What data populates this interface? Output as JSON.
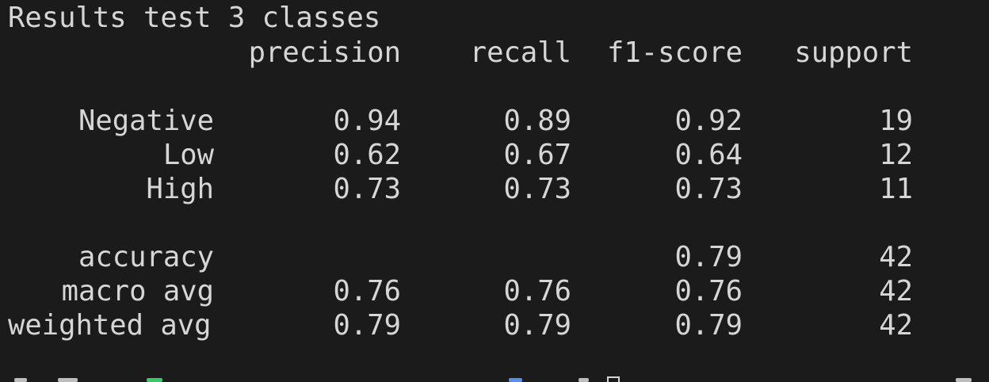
{
  "terminal": {
    "title_line": "Results test 3 classes",
    "headers": {
      "precision": "precision",
      "recall": "recall",
      "f1_score": "f1-score",
      "support": "support"
    },
    "class_rows": [
      {
        "label": "Negative",
        "precision": "0.94",
        "recall": "0.89",
        "f1_score": "0.92",
        "support": "19"
      },
      {
        "label": "Low",
        "precision": "0.62",
        "recall": "0.67",
        "f1_score": "0.64",
        "support": "12"
      },
      {
        "label": "High",
        "precision": "0.73",
        "recall": "0.73",
        "f1_score": "0.73",
        "support": "11"
      }
    ],
    "summary_rows": [
      {
        "label": "accuracy",
        "precision": "",
        "recall": "",
        "f1_score": "0.79",
        "support": "42"
      },
      {
        "label": "macro avg",
        "precision": "0.76",
        "recall": "0.76",
        "f1_score": "0.76",
        "support": "42"
      },
      {
        "label": "weighted avg",
        "precision": "0.79",
        "recall": "0.79",
        "f1_score": "0.79",
        "support": "42"
      }
    ],
    "colors": {
      "background": "#1b1b1b",
      "text": "#d6d6d6"
    }
  }
}
